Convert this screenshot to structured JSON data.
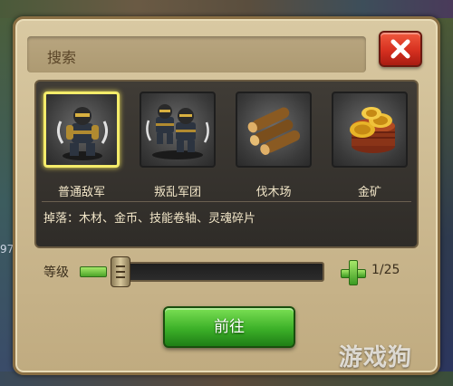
{
  "dialog": {
    "search_title": "搜索",
    "close_icon": "close-x-icon",
    "categories": [
      {
        "label": "普通敌军",
        "icon": "ninja-soldier-icon",
        "selected": true
      },
      {
        "label": "叛乱军团",
        "icon": "ninja-squad-icon",
        "selected": false
      },
      {
        "label": "伐木场",
        "icon": "wood-logs-icon",
        "selected": false
      },
      {
        "label": "金矿",
        "icon": "gold-coins-icon",
        "selected": false
      }
    ],
    "drops_text": "掉落：木材、金币、技能卷轴、灵魂碎片",
    "level": {
      "label": "等级",
      "value": 1,
      "max": 25,
      "display": "1/25"
    },
    "go_button": "前往"
  },
  "background": {
    "left_number": "97"
  },
  "watermark": "游戏狗",
  "colors": {
    "close_button": "#d63020",
    "go_button": "#3cb028",
    "selected_border": "#f4ec6a",
    "dialog_bg": "#cbb88f"
  }
}
